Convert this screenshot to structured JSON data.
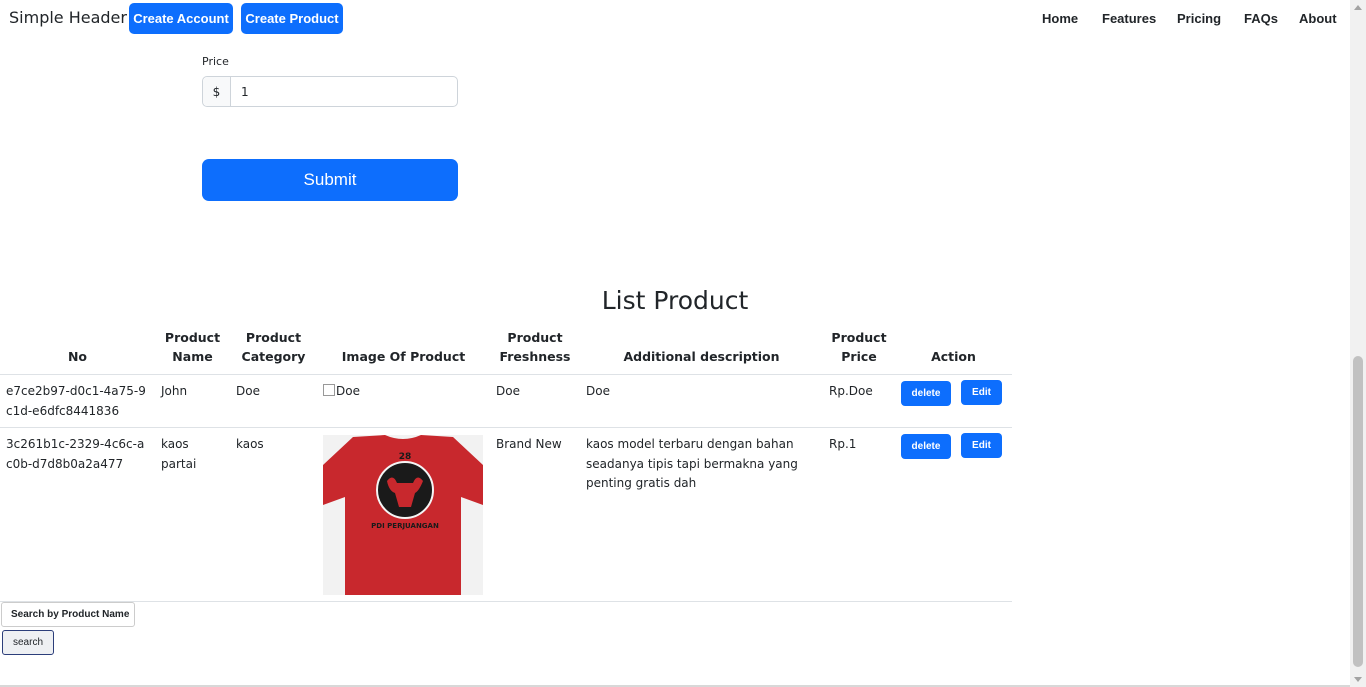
{
  "header": {
    "brand": "Simple Header",
    "buttons": [
      "Create Account",
      "Create Product"
    ],
    "nav": [
      "Home",
      "Features",
      "Pricing",
      "FAQs",
      "About"
    ]
  },
  "form": {
    "price_label": "Price",
    "currency_symbol": "$",
    "price_value": "1",
    "submit_label": "Submit"
  },
  "list": {
    "title": "List Product",
    "columns": [
      "No",
      "Product Name",
      "Product Category",
      "Image Of Product",
      "Product Freshness",
      "Additional description",
      "Product Price",
      "Action"
    ],
    "rows": [
      {
        "no": "e7ce2b97-d0c1-4a75-9c1d-e6dfc8441836",
        "name": "John",
        "category": "Doe",
        "image_alt": "Doe",
        "freshness": "Doe",
        "description": "Doe",
        "price": "Rp.Doe",
        "delete_label": "delete",
        "edit_label": "Edit"
      },
      {
        "no": "3c261b1c-2329-4c6c-ac0b-d7d8b0a2a477",
        "name": "kaos partai",
        "category": "kaos",
        "image_alt": "",
        "freshness": "Brand New",
        "description": "kaos model terbaru dengan bahan seadanya tipis tapi bermakna yang penting gratis dah",
        "price": "Rp.1",
        "delete_label": "delete",
        "edit_label": "Edit"
      }
    ],
    "shirt_text": {
      "number": "28",
      "caption": "PDI PERJUANGAN"
    }
  },
  "search": {
    "placeholder": "Search by Product Name",
    "button_label": "search"
  },
  "colors": {
    "primary": "#0d6efd",
    "shirt_red": "#c8282d"
  }
}
